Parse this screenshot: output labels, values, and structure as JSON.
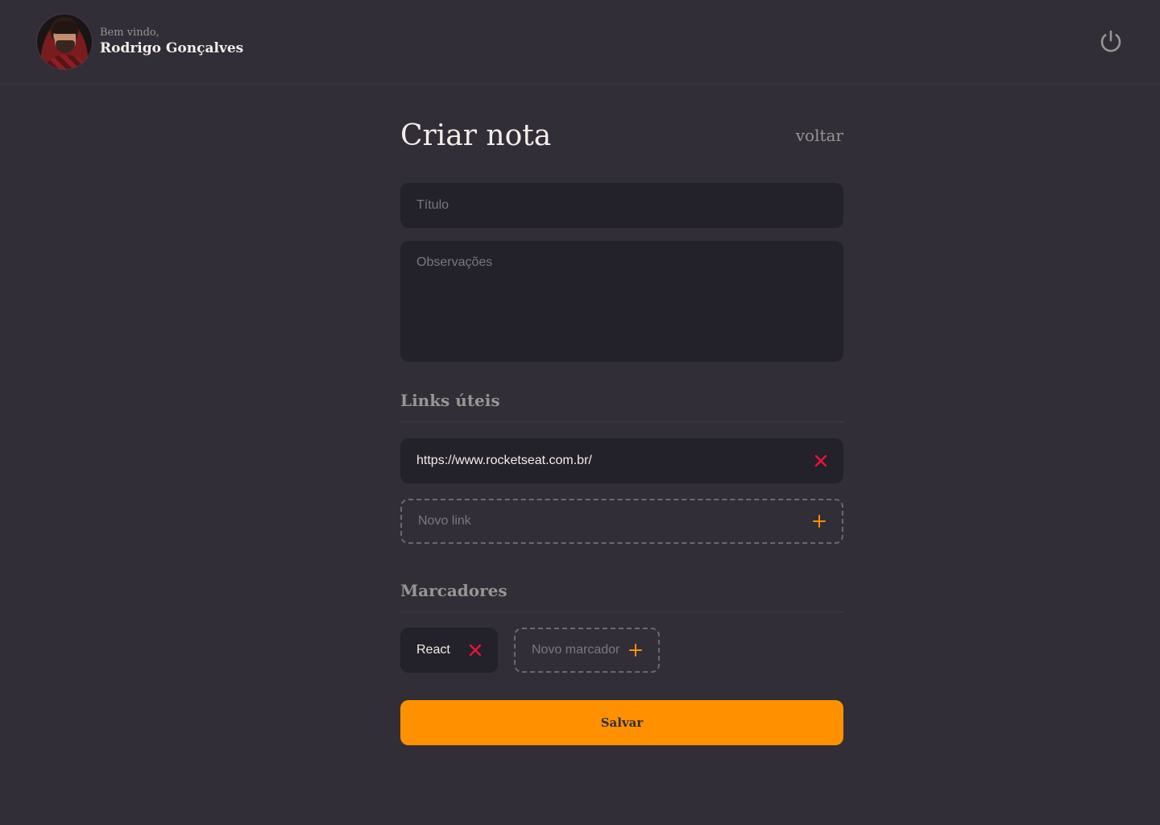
{
  "header": {
    "greeting": "Bem vindo,",
    "user_name": "Rodrigo Gonçalves",
    "logout_icon": "power-icon"
  },
  "page": {
    "title": "Criar nota",
    "back_link": "voltar"
  },
  "form": {
    "title_placeholder": "Título",
    "notes_placeholder": "Observações"
  },
  "links": {
    "section_title": "Links úteis",
    "items": [
      {
        "value": "https://www.rocketseat.com.br/",
        "remove_icon": "close-icon"
      }
    ],
    "new_placeholder": "Novo link",
    "add_icon": "plus-icon"
  },
  "tags": {
    "section_title": "Marcadores",
    "items": [
      {
        "value": "React",
        "remove_icon": "close-icon"
      }
    ],
    "new_placeholder": "Novo marcador",
    "add_icon": "plus-icon"
  },
  "save_label": "Salvar",
  "colors": {
    "background": "#312E38",
    "input_background": "#232129",
    "accent": "#FF9000",
    "danger": "#E8133E",
    "muted_text": "#999591"
  }
}
